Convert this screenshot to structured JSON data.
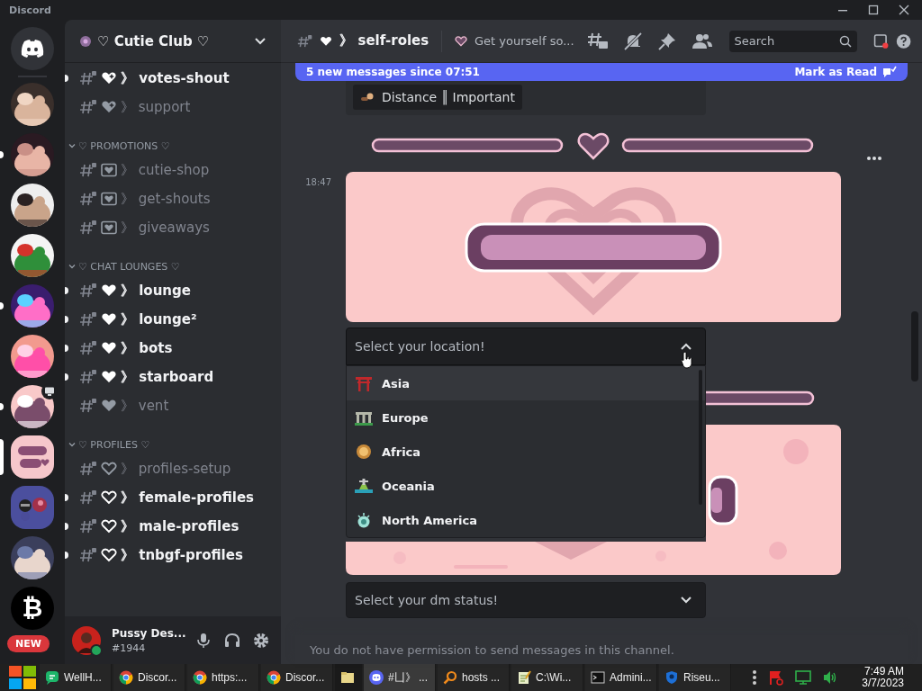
{
  "window": {
    "title": "Discord"
  },
  "servers": [
    {
      "kind": "logo",
      "unread": false,
      "selected": false,
      "streaming": false
    },
    {
      "kind": "picture",
      "unread": false,
      "selected": false,
      "streaming": false
    },
    {
      "kind": "picture",
      "unread": true,
      "selected": false,
      "streaming": false
    },
    {
      "kind": "picture",
      "unread": false,
      "selected": false,
      "streaming": false
    },
    {
      "kind": "picture",
      "unread": false,
      "selected": false,
      "streaming": false
    },
    {
      "kind": "picture",
      "unread": true,
      "selected": false,
      "streaming": false
    },
    {
      "kind": "picture",
      "unread": false,
      "selected": false,
      "streaming": false
    },
    {
      "kind": "picture",
      "unread": true,
      "selected": false,
      "streaming": true
    },
    {
      "kind": "club",
      "unread": false,
      "selected": true,
      "streaming": false
    },
    {
      "kind": "folder",
      "unread": false,
      "selected": false,
      "streaming": false
    },
    {
      "kind": "picture",
      "unread": false,
      "selected": false,
      "streaming": false
    },
    {
      "kind": "coin",
      "label": "₿",
      "unread": false,
      "selected": false,
      "streaming": false
    }
  ],
  "new_badge": "NEW",
  "server": {
    "name": "♡ Cutie Club ♡"
  },
  "channel_groups": [
    {
      "channels": [
        {
          "name": "》 votes-shout",
          "kind": "sparkle",
          "unread": true
        },
        {
          "name": "》 support",
          "kind": "sparkle",
          "unread": false
        }
      ]
    },
    {
      "category": "♡ PROMOTIONS ♡",
      "channels": [
        {
          "name": "》 cutie-shop",
          "kind": "frame",
          "unread": false
        },
        {
          "name": "》 get-shouts",
          "kind": "frame",
          "unread": false
        },
        {
          "name": "》 giveaways",
          "kind": "frame",
          "unread": false
        }
      ]
    },
    {
      "category": "♡ CHAT LOUNGES ♡",
      "channels": [
        {
          "name": "》 lounge",
          "kind": "heart",
          "unread": true
        },
        {
          "name": "》 lounge²",
          "kind": "heart",
          "unread": true
        },
        {
          "name": "》 bots",
          "kind": "heart",
          "unread": true
        },
        {
          "name": "》 starboard",
          "kind": "heart",
          "unread": true
        },
        {
          "name": "》 vent",
          "kind": "heart",
          "unread": false
        }
      ]
    },
    {
      "category": "♡ PROFILES ♡",
      "channels": [
        {
          "name": "》 profiles-setup",
          "kind": "outline",
          "unread": false
        },
        {
          "name": "》 female-profiles",
          "kind": "outline",
          "unread": true
        },
        {
          "name": "》 male-profiles",
          "kind": "outline",
          "unread": true
        },
        {
          "name": "》 tnbgf-profiles",
          "kind": "outline",
          "unread": true
        }
      ]
    }
  ],
  "user": {
    "name": "Pussy Des...",
    "tag": "#1944",
    "online": true
  },
  "header": {
    "channel": "》 self-roles",
    "topic": "Get yourself so...",
    "search": {
      "placeholder": "Search"
    }
  },
  "new_messages": {
    "text": "5 new messages since 07:51",
    "action": "Mark as Read"
  },
  "embed": {
    "button": "Distance ║ Important"
  },
  "message": {
    "time": "18:47"
  },
  "location_select": {
    "placeholder": "Select your location!",
    "expanded": true,
    "options": [
      {
        "label": "Asia",
        "kind": "gate",
        "highlighted": true
      },
      {
        "label": "Europe",
        "kind": "stones",
        "highlighted": false
      },
      {
        "label": "Africa",
        "kind": "lion",
        "highlighted": false
      },
      {
        "label": "Oceania",
        "kind": "statue",
        "highlighted": false
      },
      {
        "label": "North America",
        "kind": "liberty",
        "highlighted": false
      }
    ]
  },
  "dm_select": {
    "placeholder": "Select your dm status!",
    "expanded": false
  },
  "composer": {
    "placeholder": "You do not have permission to send messages in this channel."
  },
  "taskbar": {
    "items": [
      {
        "label": "WellH...",
        "kind": "chat",
        "active": false
      },
      {
        "label": "Discor...",
        "kind": "chrome",
        "active": false
      },
      {
        "label": "https:...",
        "kind": "chrome",
        "active": false
      },
      {
        "label": "Discor...",
        "kind": "chrome",
        "active": false
      },
      {
        "kind": "folder",
        "active": false
      },
      {
        "label": "#凵》 ...",
        "kind": "discord",
        "active": true
      },
      {
        "label": "hosts ...",
        "kind": "search",
        "active": false
      },
      {
        "label": "C:\\Wi...",
        "kind": "notepad",
        "active": false
      },
      {
        "label": "Admini...",
        "kind": "console",
        "active": false
      },
      {
        "label": "Riseu...",
        "kind": "shield",
        "active": false
      }
    ],
    "time": "7:49 AM",
    "date": "3/7/2023"
  }
}
